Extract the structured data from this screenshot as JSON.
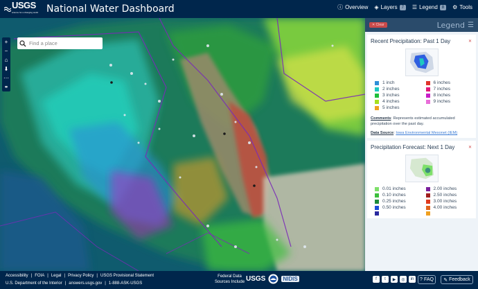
{
  "header": {
    "logo_text": "USGS",
    "logo_tagline": "science for a changing world",
    "title": "National Water Dashboard",
    "nav": [
      {
        "label": "Overview",
        "icon": "info-icon"
      },
      {
        "label": "Layers",
        "icon": "layers-icon",
        "badge": "7"
      },
      {
        "label": "Legend",
        "icon": "legend-icon",
        "badge": "8"
      },
      {
        "label": "Tools",
        "icon": "gear-icon"
      }
    ]
  },
  "map": {
    "search_placeholder": "Find a place",
    "zoom_controls": [
      "+",
      "−",
      "⌂",
      "⬇",
      "⋯",
      "⚭"
    ]
  },
  "legend_panel": {
    "clear_label": "Clear",
    "title": "Legend",
    "cards": [
      {
        "title": "Recent Precipitation: Past 1 Day",
        "swatches": [
          {
            "label": "1 inch",
            "color": "#2f8fd8"
          },
          {
            "label": "6 inches",
            "color": "#e0342b"
          },
          {
            "label": "2 inches",
            "color": "#1ec8c0"
          },
          {
            "label": "7 inches",
            "color": "#e0197a"
          },
          {
            "label": "3 inches",
            "color": "#1fbf3a"
          },
          {
            "label": "8 inches",
            "color": "#c81ec8"
          },
          {
            "label": "4 inches",
            "color": "#a8e01e"
          },
          {
            "label": "9 inches",
            "color": "#e86fd8"
          },
          {
            "label": "5 inches",
            "color": "#f0a020"
          }
        ],
        "comments_label": "Comments",
        "comments": "Represents estimated accumulated precipitation over the past day.",
        "data_source_label": "Data Source",
        "data_source": "Iowa Environmental Mesonet (IEM)"
      },
      {
        "title": "Precipitation Forecast: Next 1 Day",
        "swatches": [
          {
            "label": "0.01 inches",
            "color": "#7ee06a"
          },
          {
            "label": "2.00 inches",
            "color": "#7a1e9c"
          },
          {
            "label": "0.10 inches",
            "color": "#3cbf3c"
          },
          {
            "label": "2.50 inches",
            "color": "#a01e1e"
          },
          {
            "label": "0.25 inches",
            "color": "#1e8c3c"
          },
          {
            "label": "3.00 inches",
            "color": "#e03a1e"
          },
          {
            "label": "0.50 inches",
            "color": "#1e4ed8"
          },
          {
            "label": "4.00 inches",
            "color": "#e0641e"
          },
          {
            "label": "",
            "color": "#2a2aa0"
          },
          {
            "label": "",
            "color": "#f0a020"
          }
        ]
      }
    ]
  },
  "footer": {
    "links_row1": [
      "Accessibility",
      "FOIA",
      "Legal",
      "Privacy Policy",
      "USGS Provisional Statement"
    ],
    "links_row2": [
      "U.S. Department of the Interior",
      "answers.usgs.gov",
      "1-888-ASK-USGS"
    ],
    "federal_line1": "Federal Data",
    "federal_line2": "Sources Include",
    "partner_usgs": "USGS",
    "partner_nidis": "NIDIS",
    "social": [
      "f",
      "t",
      "▶",
      "◎",
      "in"
    ],
    "faq_label": "FAQ",
    "feedback_label": "Feedback"
  },
  "colors": {
    "header_bg": "#00264c",
    "panel_header_bg": "#2a4b6b",
    "panel_bg": "#eef3f8"
  }
}
